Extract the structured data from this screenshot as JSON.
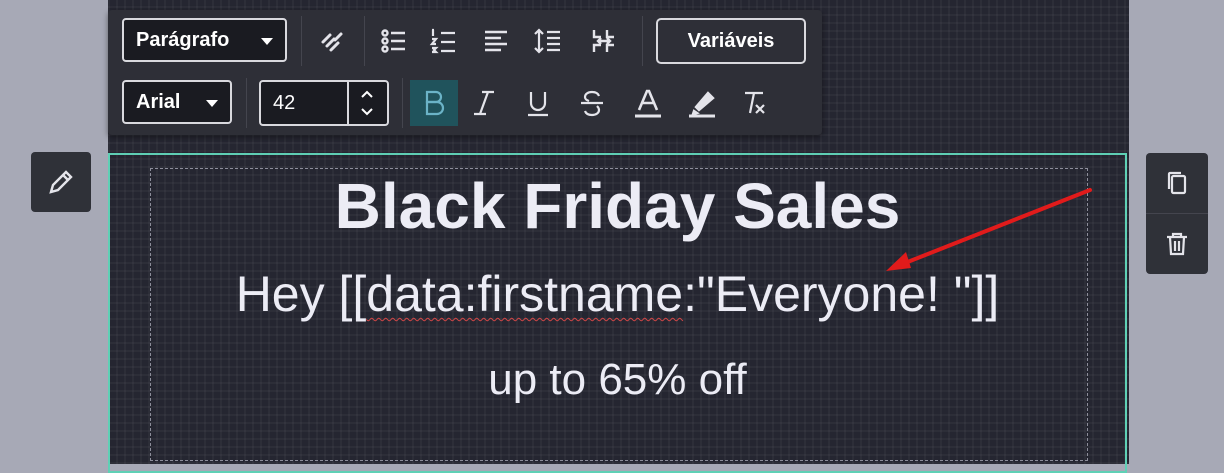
{
  "toolbar": {
    "block_type": "Parágrafo",
    "variables_label": "Variáveis",
    "font_family": "Arial",
    "font_size": "42"
  },
  "content": {
    "headline": "Black Friday Sales",
    "greeting_prefix": "Hey [[",
    "greeting_variable": "data:firstname",
    "greeting_suffix": ":\"Everyone! \"]]",
    "offer": "up to 65% off"
  },
  "icons": {
    "unlink": "unlink-icon",
    "bullet_list": "bulleted-list-icon",
    "numbered_list": "numbered-list-icon",
    "align": "align-left-icon",
    "line_height": "line-height-icon",
    "direction": "text-direction-icon",
    "bold": "bold-icon",
    "italic": "italic-icon",
    "underline": "underline-icon",
    "strikethrough": "strikethrough-icon",
    "font_color": "font-color-icon",
    "highlight": "highlight-icon",
    "clear_format": "clear-formatting-icon",
    "edit": "pencil-icon",
    "duplicate": "copy-icon",
    "delete": "trash-icon"
  },
  "colors": {
    "canvas": "#252631",
    "toolbar": "#2e2f37",
    "selection_border": "#5fd0b5",
    "bold_active": "#20535c",
    "annotation_arrow": "#e11b1b"
  }
}
